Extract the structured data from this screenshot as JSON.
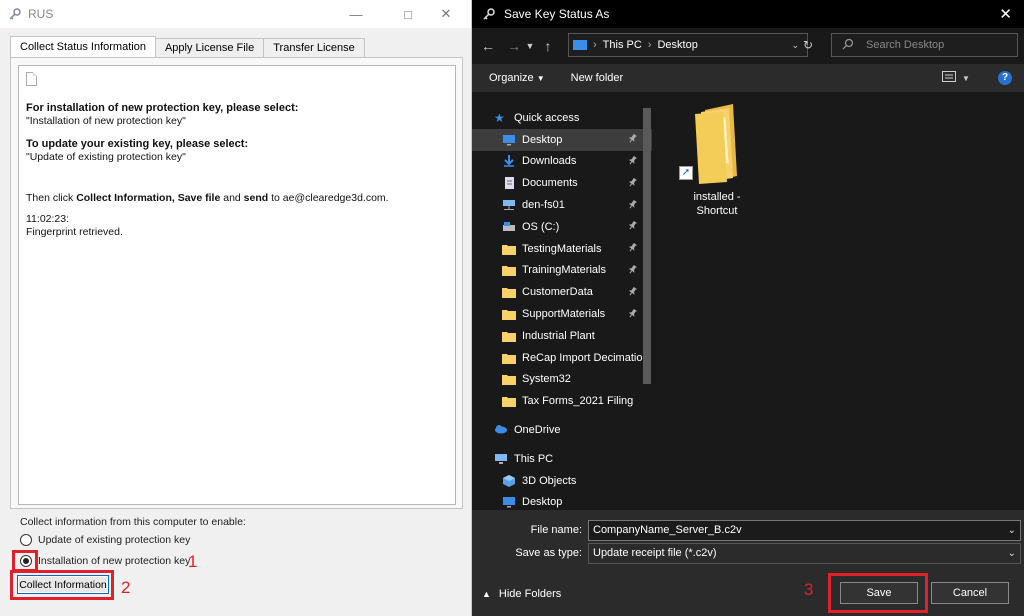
{
  "rus": {
    "title": "RUS",
    "tabs": [
      "Collect Status Information",
      "Apply License File",
      "Transfer License"
    ],
    "content": {
      "heading1": "For installation of new protection key, please select:",
      "line1": "\"Installation of new protection key\"",
      "heading2": "To update your existing key, please select:",
      "line2": "\"Update of existing protection key\"",
      "then_prefix": "Then click ",
      "then_collect": "Collect Information, Save file",
      "then_and": " and ",
      "then_send": "send",
      "then_to": " to ae@clearedge3d.com.",
      "time": "11:02:23:",
      "status": "Fingerprint retrieved."
    },
    "collect_label": "Collect information from this computer to enable:",
    "radio_update": "Update of existing protection key",
    "radio_install": "Installation of new protection key",
    "collect_button": "Collect Information",
    "annotations": [
      "1",
      "2"
    ]
  },
  "dialog": {
    "title": "Save Key Status As",
    "address": [
      "This PC",
      "Desktop"
    ],
    "search_placeholder": "Search Desktop",
    "organize": "Organize",
    "new_folder": "New folder",
    "help": "?",
    "quick_access": "Quick access",
    "nav_items": [
      {
        "label": "Desktop",
        "icon": "desktop-icon",
        "pinned": true,
        "selected": true
      },
      {
        "label": "Downloads",
        "icon": "downloads-icon",
        "pinned": true
      },
      {
        "label": "Documents",
        "icon": "documents-icon",
        "pinned": true
      },
      {
        "label": "den-fs01",
        "icon": "network-drive-icon",
        "pinned": true
      },
      {
        "label": "OS (C:)",
        "icon": "drive-icon",
        "pinned": true
      },
      {
        "label": "TestingMaterials",
        "icon": "folder-icon",
        "pinned": true
      },
      {
        "label": "TrainingMaterials",
        "icon": "folder-icon",
        "pinned": true
      },
      {
        "label": "CustomerData",
        "icon": "folder-icon",
        "pinned": true
      },
      {
        "label": "SupportMaterials",
        "icon": "folder-icon",
        "pinned": true
      },
      {
        "label": "Industrial Plant",
        "icon": "folder-icon",
        "pinned": false
      },
      {
        "label": "ReCap Import Decimation",
        "icon": "folder-icon",
        "pinned": false
      },
      {
        "label": "System32",
        "icon": "folder-icon",
        "pinned": false
      },
      {
        "label": "Tax Forms_2021 Filing",
        "icon": "folder-icon",
        "pinned": false
      }
    ],
    "onedrive": "OneDrive",
    "this_pc": "This PC",
    "this_pc_items": [
      {
        "label": "3D Objects",
        "icon": "3d-objects-icon"
      },
      {
        "label": "Desktop",
        "icon": "desktop-icon"
      }
    ],
    "file_item": "installed - Shortcut",
    "file_name_label": "File name:",
    "file_name_value": "CompanyName_Server_B.c2v",
    "save_type_label": "Save as type:",
    "save_type_value": "Update receipt file (*.c2v)",
    "hide_folders": "Hide Folders",
    "save_button": "Save",
    "cancel_button": "Cancel",
    "annotation": "3"
  },
  "colors": {
    "highlight": "#e2202a",
    "dialog_bg": "#191919",
    "folder": "#f7d26b",
    "accent_blue": "#3b8ee8"
  }
}
